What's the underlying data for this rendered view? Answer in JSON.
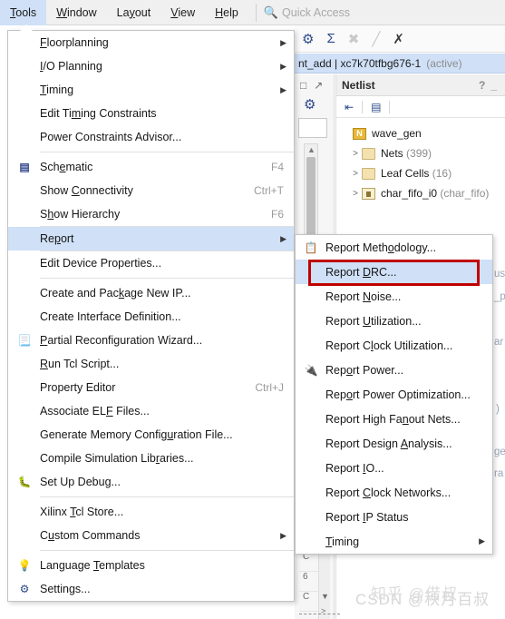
{
  "menubar": {
    "items": [
      {
        "label": "Tools",
        "mnemonic": "T",
        "active": true
      },
      {
        "label": "Window",
        "mnemonic": "W",
        "active": false
      },
      {
        "label": "Layout",
        "mnemonic": "y",
        "active": false
      },
      {
        "label": "View",
        "mnemonic": "V",
        "active": false
      },
      {
        "label": "Help",
        "mnemonic": "H",
        "active": false
      }
    ],
    "quick_access_placeholder": "Quick Access",
    "search_icon": "search-icon"
  },
  "design_bar": {
    "title": "nt_add | xc7k70tfbg676-1",
    "state": "(active)"
  },
  "netlist_panel": {
    "title": "Netlist",
    "help_button": "?",
    "more_button": "_",
    "tree": [
      {
        "label": "wave_gen",
        "suffix": "",
        "icon": "module-icon",
        "indent": 0,
        "expander": ""
      },
      {
        "label": "Nets",
        "suffix": "(399)",
        "icon": "folder-icon",
        "indent": 1,
        "expander": ">"
      },
      {
        "label": "Leaf Cells",
        "suffix": "(16)",
        "icon": "folder-icon",
        "indent": 1,
        "expander": ">"
      },
      {
        "label": "char_fifo_i0",
        "suffix": "(char_fifo)",
        "icon": "chip-icon",
        "indent": 1,
        "expander": ">"
      }
    ]
  },
  "background_ghost_text": [
    "us",
    "_p",
    "ar",
    ")",
    "ge",
    "ra"
  ],
  "bottom_cells": [
    "C",
    "6",
    "C"
  ],
  "tools_menu": {
    "name": "Tools",
    "items": [
      {
        "label": "Floorplanning",
        "mnemonic": "F",
        "accel": "",
        "submenu": true,
        "icon": "",
        "sep_after": false
      },
      {
        "label": "I/O Planning",
        "mnemonic": "I",
        "accel": "",
        "submenu": true,
        "icon": "",
        "sep_after": false
      },
      {
        "label": "Timing",
        "mnemonic": "T",
        "accel": "",
        "submenu": true,
        "icon": "",
        "sep_after": false
      },
      {
        "label": "Edit Timing Constraints",
        "mnemonic": "m",
        "accel": "",
        "submenu": false,
        "icon": "",
        "sep_after": false
      },
      {
        "label": "Power Constraints Advisor...",
        "mnemonic": "",
        "accel": "",
        "submenu": false,
        "icon": "",
        "sep_after": true
      },
      {
        "label": "Schematic",
        "mnemonic": "e",
        "accel": "F4",
        "submenu": false,
        "icon": "schematic-icon",
        "sep_after": false
      },
      {
        "label": "Show Connectivity",
        "mnemonic": "C",
        "accel": "Ctrl+T",
        "submenu": false,
        "icon": "",
        "sep_after": false
      },
      {
        "label": "Show Hierarchy",
        "mnemonic": "h",
        "accel": "F6",
        "submenu": false,
        "icon": "",
        "sep_after": true
      },
      {
        "label": "Report",
        "mnemonic": "p",
        "accel": "",
        "submenu": true,
        "icon": "",
        "sep_after": false,
        "highlighted": true
      },
      {
        "label": "Edit Device Properties...",
        "mnemonic": "",
        "accel": "",
        "submenu": false,
        "icon": "",
        "sep_after": true
      },
      {
        "label": "Create and Package New IP...",
        "mnemonic": "k",
        "accel": "",
        "submenu": false,
        "icon": "",
        "sep_after": false
      },
      {
        "label": "Create Interface Definition...",
        "mnemonic": "",
        "accel": "",
        "submenu": false,
        "icon": "",
        "sep_after": false
      },
      {
        "label": "Partial Reconfiguration Wizard...",
        "mnemonic": "P",
        "accel": "",
        "submenu": false,
        "icon": "ip-package-icon",
        "sep_after": false
      },
      {
        "label": "Run Tcl Script...",
        "mnemonic": "R",
        "accel": "",
        "submenu": false,
        "icon": "",
        "sep_after": false
      },
      {
        "label": "Property Editor",
        "mnemonic": "",
        "accel": "Ctrl+J",
        "submenu": false,
        "icon": "",
        "sep_after": false
      },
      {
        "label": "Associate ELF Files...",
        "mnemonic": "F",
        "accel": "",
        "submenu": false,
        "icon": "",
        "sep_after": false
      },
      {
        "label": "Generate Memory Configuration File...",
        "mnemonic": "u",
        "accel": "",
        "submenu": false,
        "icon": "",
        "sep_after": false
      },
      {
        "label": "Compile Simulation Libraries...",
        "mnemonic": "r",
        "accel": "",
        "submenu": false,
        "icon": "",
        "sep_after": false
      },
      {
        "label": "Set Up Debug...",
        "mnemonic": "",
        "accel": "",
        "submenu": false,
        "icon": "debug-icon",
        "sep_after": true
      },
      {
        "label": "Xilinx Tcl Store...",
        "mnemonic": "T",
        "accel": "",
        "submenu": false,
        "icon": "",
        "sep_after": false
      },
      {
        "label": "Custom Commands",
        "mnemonic": "u",
        "accel": "",
        "submenu": true,
        "icon": "",
        "sep_after": true
      },
      {
        "label": "Language Templates",
        "mnemonic": "T",
        "accel": "",
        "submenu": false,
        "icon": "bulb-icon",
        "sep_after": false
      },
      {
        "label": "Settings...",
        "mnemonic": "",
        "accel": "",
        "submenu": false,
        "icon": "gear-icon",
        "sep_after": false
      }
    ]
  },
  "report_submenu": {
    "name": "Report",
    "items": [
      {
        "label": "Report Methodology...",
        "icon": "methodology-icon",
        "submenu": false,
        "highlighted": false
      },
      {
        "label": "Report DRC...",
        "icon": "",
        "submenu": false,
        "highlighted": true
      },
      {
        "label": "Report Noise...",
        "icon": "",
        "submenu": false,
        "highlighted": false
      },
      {
        "label": "Report Utilization...",
        "icon": "",
        "submenu": false,
        "highlighted": false
      },
      {
        "label": "Report Clock Utilization...",
        "icon": "",
        "submenu": false,
        "highlighted": false
      },
      {
        "label": "Report Power...",
        "icon": "power-icon",
        "submenu": false,
        "highlighted": false
      },
      {
        "label": "Report Power Optimization...",
        "icon": "",
        "submenu": false,
        "highlighted": false
      },
      {
        "label": "Report High Fanout Nets...",
        "icon": "",
        "submenu": false,
        "highlighted": false
      },
      {
        "label": "Report Design Analysis...",
        "icon": "",
        "submenu": false,
        "highlighted": false
      },
      {
        "label": "Report IO...",
        "icon": "",
        "submenu": false,
        "highlighted": false
      },
      {
        "label": "Report Clock Networks...",
        "icon": "",
        "submenu": false,
        "highlighted": false
      },
      {
        "label": "Report IP Status",
        "icon": "",
        "submenu": false,
        "highlighted": false
      },
      {
        "label": "Timing",
        "icon": "",
        "submenu": true,
        "highlighted": false
      }
    ]
  },
  "annotation": {
    "highlight_color": "#c00000",
    "selection_color": "#cfe0f7"
  },
  "watermark": {
    "primary": "CSDN @秋月百叔",
    "secondary": "知乎 @借叔"
  }
}
